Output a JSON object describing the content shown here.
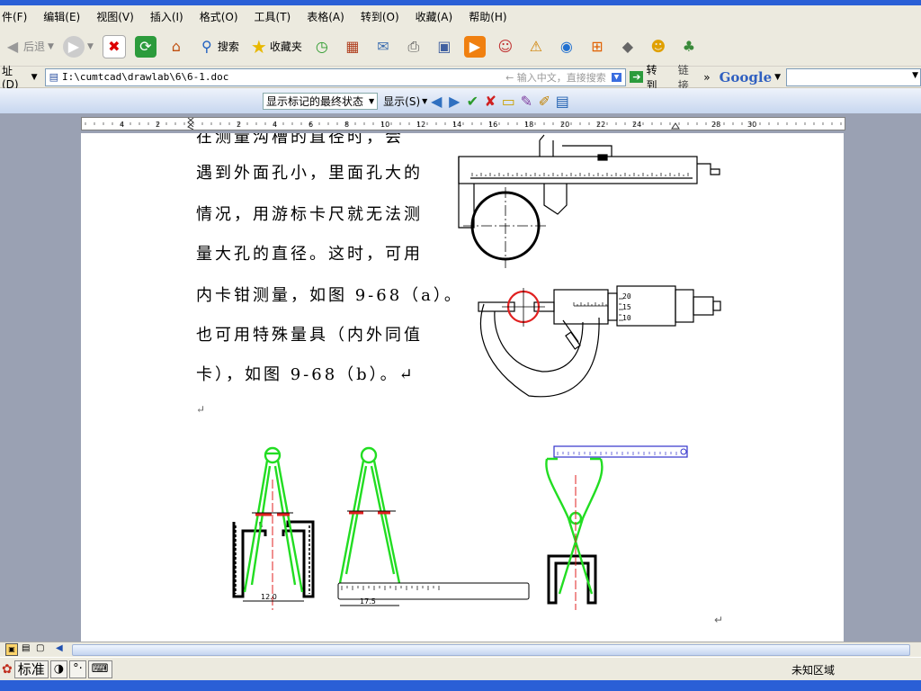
{
  "menu": [
    "件(F)",
    "编辑(E)",
    "视图(V)",
    "插入(I)",
    "格式(O)",
    "工具(T)",
    "表格(A)",
    "转到(O)",
    "收藏(A)",
    "帮助(H)"
  ],
  "toolbar": {
    "back_label": "后退",
    "search_label": "搜索",
    "favorites_label": "收藏夹"
  },
  "address": {
    "label": "址(D)",
    "path": "I:\\cumtcad\\drawlab\\6\\6-1.doc",
    "search_hint": "← 输入中文，直接搜索",
    "go_label": "转到",
    "links_label": "链接",
    "more": "»",
    "google_label": "Google"
  },
  "review": {
    "state_label": "显示标记的最终状态",
    "show_label": "显示(S)"
  },
  "ruler": {
    "labels": [
      "4",
      "2",
      "2",
      "4",
      "6",
      "8",
      "10",
      "12",
      "14",
      "16",
      "18",
      "20",
      "22",
      "24",
      "28",
      "30"
    ]
  },
  "document": {
    "lines": [
      "在测量沟槽的直径时，会",
      "遇到外面孔小，里面孔大的",
      "情况，用游标卡尺就无法测",
      "量大孔的直径。这时，可用",
      "内卡钳测量，如图 9-68（a）。",
      "也可用特殊量具（内外同值",
      "卡），如图 9-68（b）。↵"
    ],
    "para_mark": "↵",
    "para_mark2": "↵"
  },
  "figures": {
    "mic_scale": [
      "20",
      "15",
      "10"
    ],
    "dim_left": "12.0",
    "dim_mid": "17.5"
  },
  "statusbar": {
    "ime_label": "标准",
    "zone": "未知区域"
  },
  "colors": {
    "green": "#22dd22",
    "red": "#e02020",
    "blue": "#3333cc",
    "xp_blue": "#2a5fd6"
  }
}
